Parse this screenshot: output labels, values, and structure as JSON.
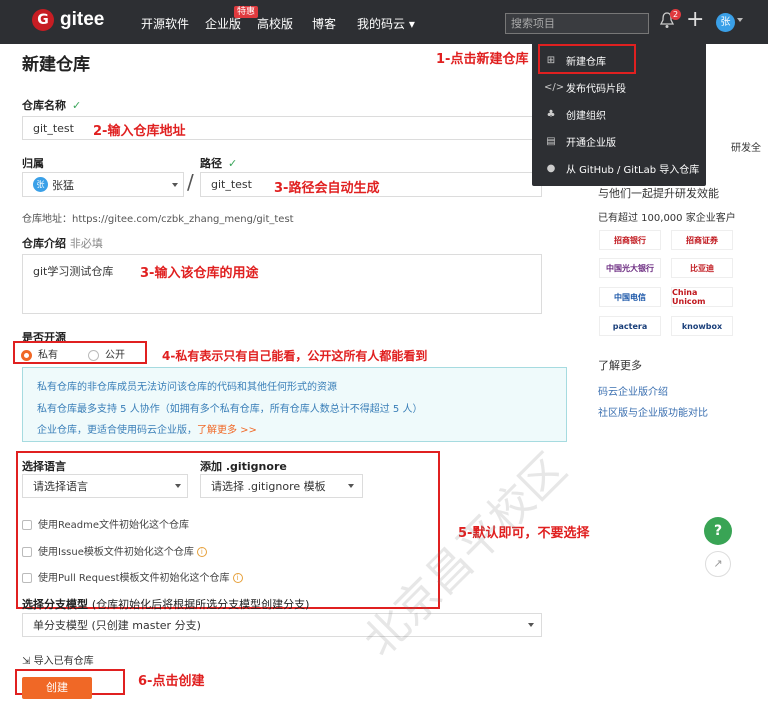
{
  "topbar": {
    "logo_text": "gitee",
    "nav": [
      "开源软件",
      "企业版",
      "高校版",
      "博客",
      "我的码云 ▾"
    ],
    "hot_badge": "特惠",
    "search_placeholder": "搜索项目",
    "bell_count": "2",
    "plus": "+",
    "avatar": "张"
  },
  "page_title": "新建仓库",
  "form": {
    "repo_name_label": "仓库名称",
    "repo_name_value": "git_test",
    "owner_label": "归属",
    "owner_value": "张猛",
    "owner_avatar": "张",
    "path_label": "路径",
    "path_value": "git_test",
    "slash": "/",
    "repo_address": "仓库地址：https://gitee.com/czbk_zhang_meng/git_test",
    "intro_label": "仓库介绍",
    "intro_optional": "非必填",
    "intro_value": "git学习测试仓库",
    "open_label": "是否开源",
    "private_label": "私有",
    "public_label": "公开",
    "info_lines": [
      "私有仓库的非仓库成员无法访问该仓库的代码和其他任何形式的资源",
      "私有仓库最多支持 5 人协作（如拥有多个私有仓库，所有仓库人数总计不得超过 5 人）",
      "企业仓库，更适合使用码云企业版，"
    ],
    "learn_more": "了解更多 >>",
    "lang_label": "选择语言",
    "lang_value": "请选择语言",
    "gitignore_label": "添加 .gitignore",
    "gitignore_value": "请选择 .gitignore 模板",
    "cb_readme": "使用Readme文件初始化这个仓库",
    "cb_issue": "使用Issue模板文件初始化这个仓库",
    "cb_pr": "使用Pull Request模板文件初始化这个仓库",
    "branch_label": "选择分支模型",
    "branch_hint": "(仓库初始化后将根据所选分支模型创建分支)",
    "branch_value": "单分支模型 (只创建 master 分支)",
    "import_label": "导入已有仓库",
    "create_label": "创建"
  },
  "annotations": {
    "a1": "1-点击新建仓库",
    "a2": "2-输入仓库地址",
    "a3": "3-路径会自动生成",
    "a4": "3-输入该仓库的用途",
    "a5": "4-私有表示只有自己能看，公开这所有人都能看到",
    "a6": "5-默认即可，不要选择",
    "a7": "6-点击创建"
  },
  "dropdown": {
    "items": [
      "新建仓库",
      "发布代码片段",
      "创建组织",
      "开通企业版",
      "从 GitHub / GitLab 导入仓库"
    ],
    "icons": [
      "plus-square-icon",
      "code-icon",
      "group-icon",
      "building-icon",
      "github-icon"
    ]
  },
  "sidebar": {
    "partial_text": "研发全",
    "promo": "与他们一起提升研发效能",
    "customers": "已有超过 100,000 家企业客户",
    "logos": [
      "招商银行",
      "招商证券",
      "中国光大银行",
      "比亚迪",
      "中国电信",
      "China Unicom",
      "pactera",
      "knowbox"
    ],
    "more_title": "了解更多",
    "link1": "码云企业版介绍",
    "link2": "社区版与企业版功能对比"
  },
  "float": {
    "help": "?",
    "share": "↗"
  },
  "watermark": "北京昌平校区"
}
